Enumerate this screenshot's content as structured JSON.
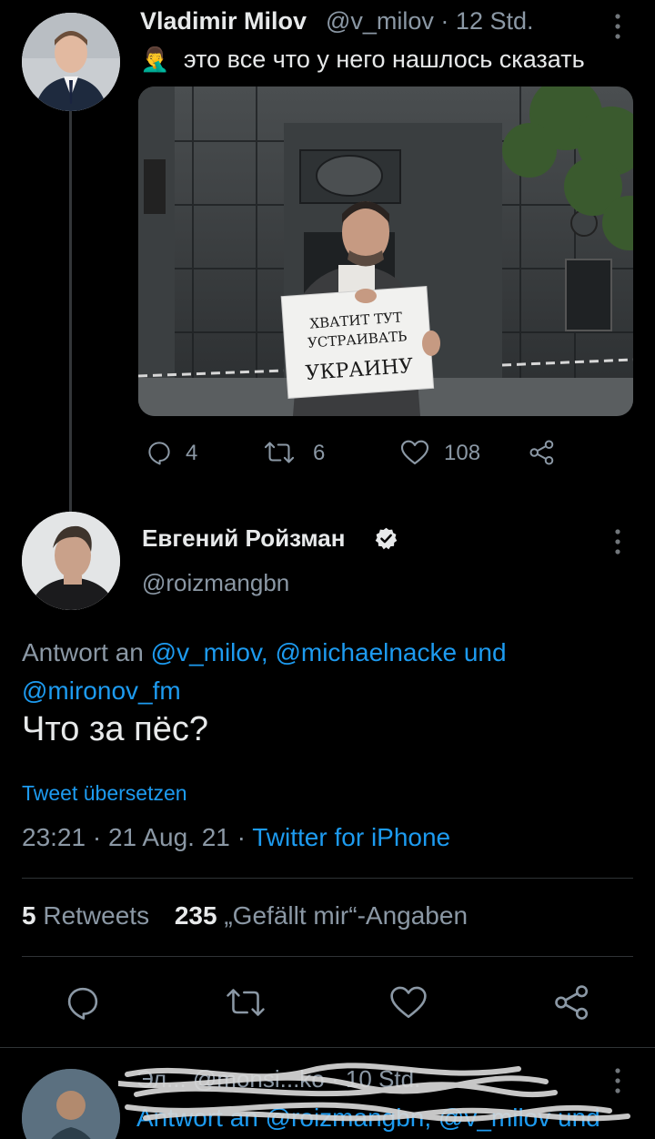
{
  "tweet1": {
    "author_name": "Vladimir Milov",
    "handle_time": "@v_milov · 12 Std.",
    "emoji": "🤦‍♂️",
    "text": "это все что у него нашлось сказать",
    "sign_lines": [
      "ХВАТИТ ТУТ",
      "УСТРАИВАТЬ",
      "УКРАИНУ"
    ],
    "replies": "4",
    "retweets": "6",
    "likes": "108"
  },
  "tweet2": {
    "author_name": "Евгений Ройзман",
    "handle": "@roizmangbn",
    "reply_prefix": "Antwort an",
    "reply_mentions": "@v_milov, @michaelnacke und @mironov_fm",
    "text": "Что за пёс?",
    "translate": "Tweet übersetzen",
    "datetime": "23:21 · 21 Aug. 21 ·",
    "client": "Twitter for iPhone",
    "retweets_count": "5",
    "retweets_label": "Retweets",
    "likes_count": "235",
    "likes_label": "„Gefällt mir“-Angaben"
  },
  "tweet3": {
    "header_partial": "Эл... @monsi...ko · 10 Std.",
    "reply_partial": "Antwort an @roizmangbn, @v_milov und"
  },
  "colors": {
    "background": "#000000",
    "text": "#e7e9ea",
    "muted": "#8b98a5",
    "accent": "#1d9bf0",
    "divider": "#2f3336"
  },
  "icons": [
    "reply-icon",
    "retweet-icon",
    "like-icon",
    "share-icon",
    "verified-icon",
    "more-icon"
  ]
}
